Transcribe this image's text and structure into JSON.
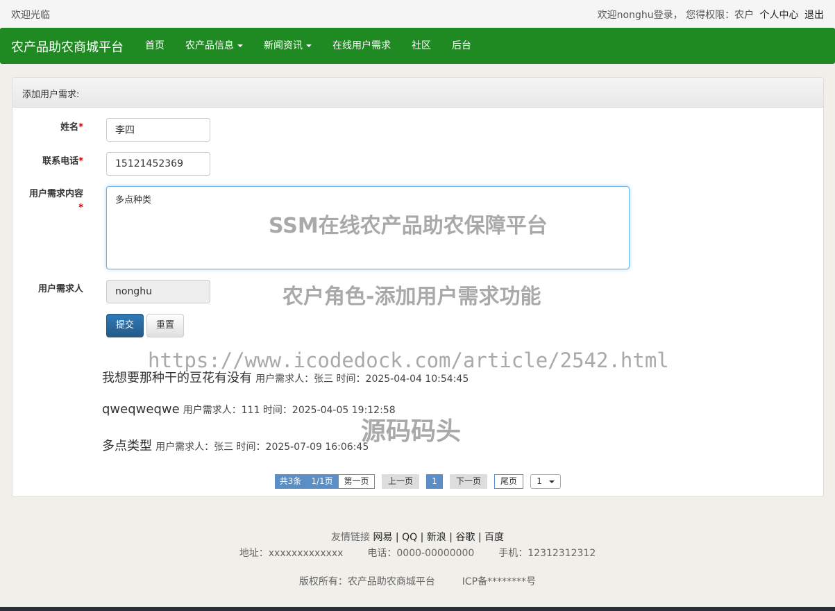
{
  "topbar": {
    "welcome": "欢迎光临",
    "login_info": "欢迎nonghu登录， 您得权限：农户",
    "personal_center": "个人中心",
    "logout": "退出"
  },
  "navbar": {
    "brand": "农产品助农商城平台",
    "items": [
      {
        "label": "首页",
        "dropdown": false
      },
      {
        "label": "农产品信息",
        "dropdown": true
      },
      {
        "label": "新闻资讯",
        "dropdown": true
      },
      {
        "label": "在线用户需求",
        "dropdown": false
      },
      {
        "label": "社区",
        "dropdown": false
      },
      {
        "label": "后台",
        "dropdown": false
      }
    ],
    "color": "#1f8a22"
  },
  "form": {
    "heading": "添加用户需求:",
    "name_label": "姓名",
    "name_value": "李四",
    "phone_label": "联系电话",
    "phone_value": "15121452369",
    "content_label": "用户需求内容",
    "content_value": "多点种类",
    "requester_label": "用户需求人",
    "requester_value": "nonghu",
    "required_mark": "*",
    "submit_label": "提交",
    "reset_label": "重置"
  },
  "demands": [
    {
      "content": "我想要那种干的豆花有没有",
      "meta": "用户需求人：张三 时间：2025-04-04 10:54:45"
    },
    {
      "content": "qweqweqwe",
      "meta": "用户需求人：111 时间：2025-04-05 19:12:58"
    },
    {
      "content": "多点类型",
      "meta": "用户需求人：张三 时间：2025-07-09 16:06:45"
    }
  ],
  "pagination": {
    "total": "共3条",
    "pages": "1/1页",
    "first": "第一页",
    "prev": "上一页",
    "current": "1",
    "next": "下一页",
    "last": "尾页",
    "select_value": "1"
  },
  "footer": {
    "links_label": "友情链接",
    "links": [
      "网易 |",
      "QQ |",
      "新浪 |",
      "谷歌 |",
      "百度"
    ],
    "address": "地址：xxxxxxxxxxxxx",
    "phone": "电话：0000-00000000",
    "mobile": "手机：12312312312",
    "copyright": "版权所有：农产品助农商城平台",
    "icp": "ICP备********号"
  },
  "watermarks": {
    "title": "SSM在线农产品助农保障平台",
    "subtitle": "农户角色-添加用户需求功能",
    "url": "https://www.icodedock.com/article/2542.html",
    "source": "源码码头"
  }
}
